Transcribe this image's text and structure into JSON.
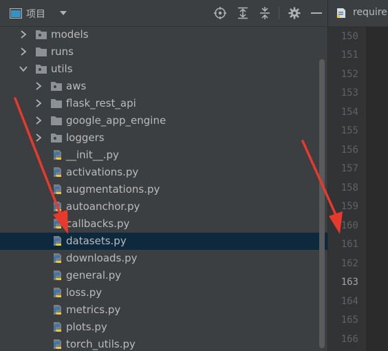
{
  "project_panel": {
    "title": "项目",
    "tree": [
      {
        "label": "models",
        "type": "package",
        "expanded": false
      },
      {
        "label": "runs",
        "type": "folder",
        "expanded": false
      },
      {
        "label": "utils",
        "type": "package",
        "expanded": true
      },
      {
        "label": "aws",
        "type": "package",
        "expanded": false
      },
      {
        "label": "flask_rest_api",
        "type": "folder",
        "expanded": false
      },
      {
        "label": "google_app_engine",
        "type": "folder",
        "expanded": false
      },
      {
        "label": "loggers",
        "type": "package",
        "expanded": false
      },
      {
        "label": "__init__.py",
        "type": "python"
      },
      {
        "label": "activations.py",
        "type": "python"
      },
      {
        "label": "augmentations.py",
        "type": "python"
      },
      {
        "label": "autoanchor.py",
        "type": "python"
      },
      {
        "label": "callbacks.py",
        "type": "python"
      },
      {
        "label": "datasets.py",
        "type": "python",
        "selected": true
      },
      {
        "label": "downloads.py",
        "type": "python"
      },
      {
        "label": "general.py",
        "type": "python"
      },
      {
        "label": "loss.py",
        "type": "python"
      },
      {
        "label": "metrics.py",
        "type": "python"
      },
      {
        "label": "plots.py",
        "type": "python"
      },
      {
        "label": "torch_utils.py",
        "type": "python"
      }
    ]
  },
  "editor": {
    "tab_label": "requirements.txt",
    "line_numbers": [
      "150",
      "151",
      "152",
      "153",
      "154",
      "155",
      "156",
      "157",
      "158",
      "159",
      "160",
      "161",
      "162",
      "163",
      "164",
      "165",
      "166"
    ],
    "current_line": "163"
  },
  "colors": {
    "panel_bg": "#3c3f41",
    "selection_bg": "#0d293e",
    "annotation_arrow": "#e8392d"
  }
}
